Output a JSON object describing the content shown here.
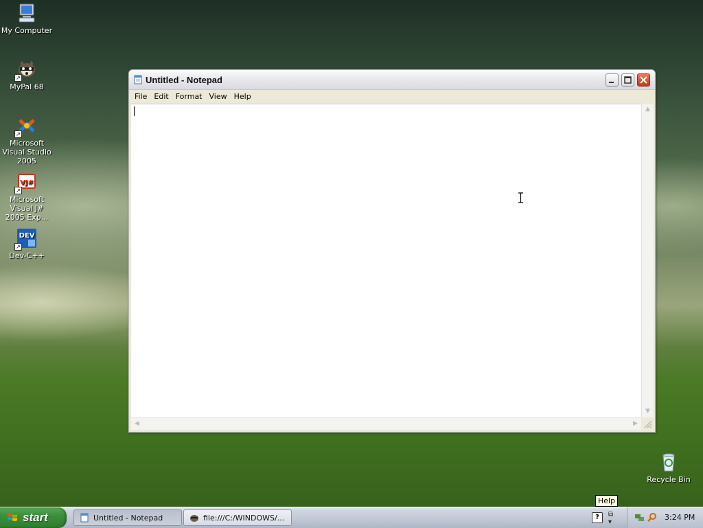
{
  "desktop": {
    "icons": [
      {
        "label": "My Computer",
        "icon": "computer-icon"
      },
      {
        "label": "MyPal 68",
        "icon": "raccoon-icon"
      },
      {
        "label": "Microsoft Visual Studio 2005",
        "icon": "visual-studio-icon"
      },
      {
        "label": "Microsoft Visual J# 2005 Exp...",
        "icon": "vjsharp-icon"
      },
      {
        "label": "Dev-C++",
        "icon": "devcpp-icon"
      },
      {
        "label": "Recycle Bin",
        "icon": "recycle-bin-icon"
      }
    ]
  },
  "window": {
    "title": "Untitled - Notepad",
    "menu": [
      "File",
      "Edit",
      "Format",
      "View",
      "Help"
    ],
    "content": ""
  },
  "taskbar": {
    "start_label": "start",
    "tasks": [
      {
        "label": "Untitled - Notepad",
        "icon": "notepad-icon",
        "active": true
      },
      {
        "label": "file:///C:/WINDOWS/...",
        "icon": "browser-icon",
        "active": false
      }
    ],
    "tooltip": "Help",
    "clock": "3:24 PM"
  },
  "colors": {
    "title_close": "#c7361a",
    "start_green": "#3b8f3b",
    "tooltip_bg": "#ffffe1"
  }
}
